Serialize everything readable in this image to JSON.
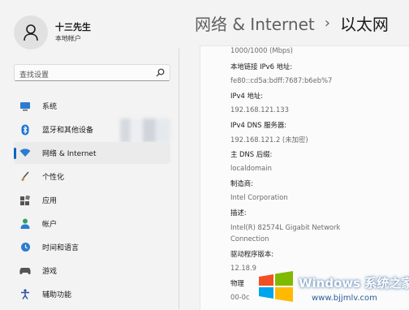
{
  "user": {
    "name": "十三先生",
    "account_type": "本地帐户"
  },
  "search": {
    "placeholder": "查找设置"
  },
  "sidebar": {
    "items": [
      {
        "label": "系统",
        "icon": "monitor-icon"
      },
      {
        "label": "蓝牙和其他设备",
        "icon": "bluetooth-icon"
      },
      {
        "label": "网络 & Internet",
        "icon": "wifi-icon",
        "active": true
      },
      {
        "label": "个性化",
        "icon": "brush-icon"
      },
      {
        "label": "应用",
        "icon": "apps-icon"
      },
      {
        "label": "帐户",
        "icon": "person-icon"
      },
      {
        "label": "时间和语言",
        "icon": "clock-globe-icon"
      },
      {
        "label": "游戏",
        "icon": "gamepad-icon"
      },
      {
        "label": "辅助功能",
        "icon": "accessibility-icon"
      }
    ]
  },
  "breadcrumb": {
    "parent": "网络 & Internet",
    "separator": "›",
    "current": "以太网"
  },
  "properties": [
    {
      "value": "1000/1000 (Mbps)"
    },
    {
      "label": "本地链接 IPv6 地址:",
      "value": "fe80::cd5a:bdff:7687:b6eb%7"
    },
    {
      "label": "IPv4 地址:",
      "value": "192.168.121.133"
    },
    {
      "label": "IPv4 DNS 服务器:",
      "value": "192.168.121.2 (未加密)"
    },
    {
      "label": "主 DNS 后缀:",
      "value": "localdomain"
    },
    {
      "label": "制造商:",
      "value": "Intel Corporation"
    },
    {
      "label": "描述:",
      "value": "Intel(R) 82574L Gigabit Network",
      "value2": "Connection"
    },
    {
      "label": "驱动程序版本:",
      "value": "12.18.9"
    },
    {
      "label": "物理",
      "value": "00-0c"
    }
  ],
  "watermark": {
    "title": "Windows 系统之家",
    "url": "www.bjjmlv.com"
  },
  "colors": {
    "accent": "#0067c0",
    "background": "#f3f3f3",
    "card": "#fbfbfb"
  }
}
